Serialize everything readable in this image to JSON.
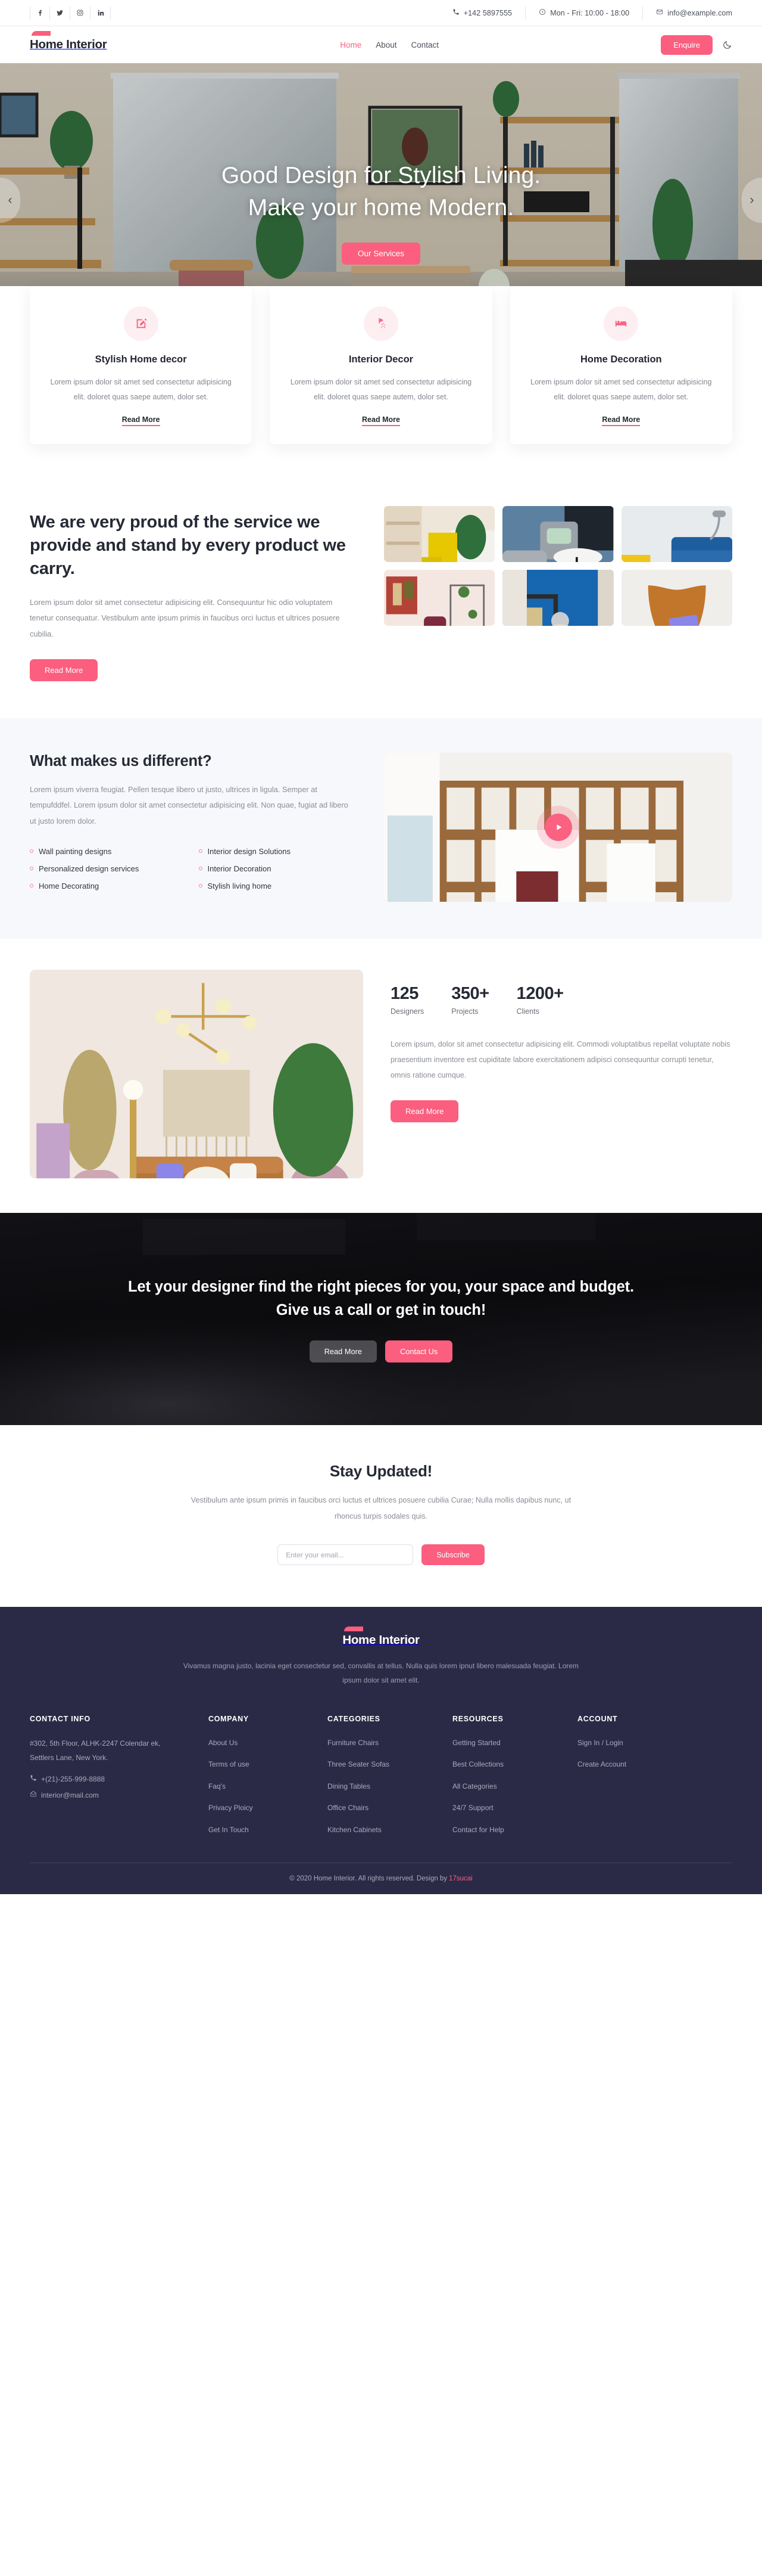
{
  "topbar": {
    "social": [
      {
        "name": "facebook-icon",
        "label": "f"
      },
      {
        "name": "twitter-icon",
        "label": "t"
      },
      {
        "name": "instagram-icon",
        "label": "ig"
      },
      {
        "name": "linkedin-icon",
        "label": "in"
      }
    ],
    "phone": "+142 5897555",
    "hours": "Mon - Fri: 10:00 - 18:00",
    "email": "info@example.com"
  },
  "nav": {
    "brand": "Home Interior",
    "menu": [
      {
        "label": "Home",
        "active": true
      },
      {
        "label": "About",
        "active": false
      },
      {
        "label": "Contact",
        "active": false
      }
    ],
    "enquire_label": "Enquire",
    "theme_toggle_icon": "moon-icon"
  },
  "hero": {
    "title_line1": "Good Design for Stylish Living.",
    "title_line2": "Make your home Modern.",
    "cta_label": "Our Services",
    "prev_icon": "chevron-left-icon",
    "next_icon": "chevron-right-icon"
  },
  "services": {
    "cards": [
      {
        "icon": "edit-square-icon",
        "title": "Stylish Home decor",
        "body": "Lorem ipsum dolor sit amet sed consectetur adipisicing elit. doloret quas saepe autem, dolor set.",
        "link": "Read More"
      },
      {
        "icon": "shower-icon",
        "title": "Interior Decor",
        "body": "Lorem ipsum dolor sit amet sed consectetur adipisicing elit. doloret quas saepe autem, dolor set.",
        "link": "Read More"
      },
      {
        "icon": "bed-icon",
        "title": "Home Decoration",
        "body": "Lorem ipsum dolor sit amet sed consectetur adipisicing elit. doloret quas saepe autem, dolor set.",
        "link": "Read More"
      }
    ]
  },
  "proud": {
    "heading": "We are very proud of the service we provide and stand by every product we carry.",
    "body": "Lorem ipsum dolor sit amet consectetur adipisicing elit. Consequuntur hic odio voluptatem tenetur consequatur. Vestibulum ante ipsum primis in faucibus orci luctus et ultrices posuere cubilia.",
    "button": "Read More",
    "gallery": [
      {
        "name": "yellow-armchair-photo"
      },
      {
        "name": "grey-sofa-coffee-table-photo"
      },
      {
        "name": "blue-sofa-photo"
      },
      {
        "name": "pink-room-artwork-photo"
      },
      {
        "name": "blue-wall-lamp-photo"
      },
      {
        "name": "orange-butterfly-chair-photo"
      }
    ]
  },
  "different": {
    "heading": "What makes us different?",
    "body": "Lorem ipsum viverra feugiat. Pellen tesque libero ut justo, ultrices in ligula. Semper at tempufddfel. Lorem ipsum dolor sit amet consectetur adipisicing elit. Non quae, fugiat ad libero ut justo lorem dolor.",
    "list_left": [
      "Wall painting designs",
      "Personalized design services",
      "Home Decorating"
    ],
    "list_right": [
      "Interior design Solutions",
      "Interior Decoration",
      "Stylish living home"
    ],
    "play_icon": "play-icon"
  },
  "stats": {
    "image_name": "living-room-sofa-photo",
    "items": [
      {
        "num": "125",
        "label": "Designers"
      },
      {
        "num": "350+",
        "label": "Projects"
      },
      {
        "num": "1200+",
        "label": "Clients"
      }
    ],
    "body": "Lorem ipsum, dolor sit amet consectetur adipisicing elit. Commodi voluptatibus repellat voluptate nobis praesentium inventore est cupiditate labore exercitationem adipisci consequuntur corrupti tenetur, omnis ratione cumque.",
    "button": "Read More"
  },
  "cta": {
    "heading": "Let your designer find the right pieces for you, your space and budget. Give us a call or get in touch!",
    "button_secondary": "Read More",
    "button_primary": "Contact Us"
  },
  "newsletter": {
    "heading": "Stay Updated!",
    "body": "Vestibulum ante ipsum primis in faucibus orci luctus et ultrices posuere cubilia Curae; Nulla mollis dapibus nunc, ut rhoncus turpis sodales quis.",
    "placeholder": "Enter your email...",
    "button": "Subscribe"
  },
  "footer": {
    "brand": "Home Interior",
    "tagline": "Vivamus magna justo, lacinia eget consectetur sed, convallis at tellus. Nulla quis lorem ipnut libero malesuada feugiat. Lorem ipsum dolor sit amet elit.",
    "contact": {
      "title": "CONTACT INFO",
      "address": "#302, 5th Floor, ALHK-2247 Colendar ek, Settlers Lane, New York.",
      "phone": "+(21)-255-999-8888",
      "email": "interior@mail.com"
    },
    "company": {
      "title": "COMPANY",
      "links": [
        "About Us",
        "Terms of use",
        "Faq's",
        "Privacy Ploicy",
        "Get In Touch"
      ]
    },
    "categories": {
      "title": "CATEGORIES",
      "links": [
        "Furniture Chairs",
        "Three Seater Sofas",
        "Dining Tables",
        "Office Chairs",
        "Kitchen Cabinets"
      ]
    },
    "resources": {
      "title": "RESOURCES",
      "links": [
        "Getting Started",
        "Best Collections",
        "All Categories",
        "24/7 Support",
        "Contact for Help"
      ]
    },
    "account": {
      "title": "ACCOUNT",
      "links": [
        "Sign In / Login",
        "Create Account"
      ]
    },
    "copyright_text": "© 2020 Home Interior. All rights reserved. Design by ",
    "copyright_link": "17sucai"
  },
  "colors": {
    "accent": "#fb5e7e",
    "dark_text": "#262a35",
    "footer_bg": "#2b2a46",
    "muted": "#8a8e96",
    "light_section": "#f7f8fc"
  }
}
